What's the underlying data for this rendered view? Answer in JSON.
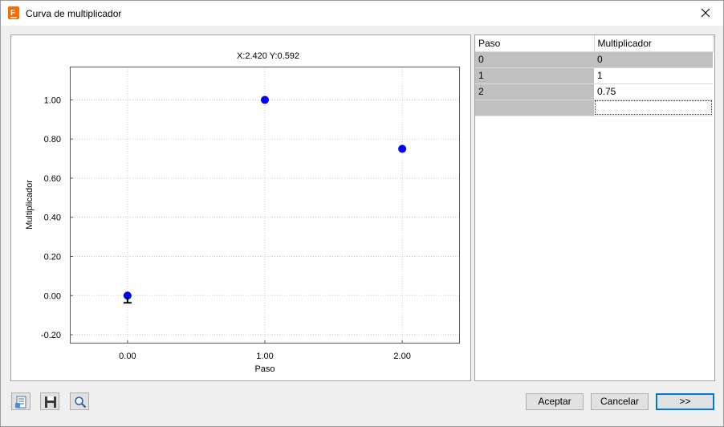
{
  "window": {
    "title": "Curva de multiplicador"
  },
  "chart": {
    "coord_readout": "X:2.420 Y:0.592",
    "chart_data": {
      "type": "scatter",
      "xlabel": "Paso",
      "ylabel": "Multiplicador",
      "x": [
        0,
        1,
        2
      ],
      "y": [
        0,
        1,
        0.75
      ],
      "xlim": [
        -0.42,
        2.42
      ],
      "ylim": [
        -0.245,
        1.17
      ],
      "xticks": [
        "0.00",
        "1.00",
        "2.00"
      ],
      "xtick_values": [
        0,
        1,
        2
      ],
      "yticks": [
        "1.00",
        "0.80",
        "0.60",
        "0.40",
        "0.20",
        "0.00",
        "-0.20"
      ],
      "ytick_values": [
        1.0,
        0.8,
        0.6,
        0.4,
        0.2,
        0.0,
        -0.2
      ],
      "grid": true,
      "marker_color": "#0000ff"
    }
  },
  "table": {
    "headers": [
      "Paso",
      "Multiplicador"
    ],
    "rows": [
      [
        "0",
        "0"
      ],
      [
        "1",
        "1"
      ],
      [
        "2",
        "0.75"
      ],
      [
        "",
        ""
      ]
    ]
  },
  "toolbar": {
    "icons": [
      "export-icon",
      "save-icon",
      "zoom-icon"
    ]
  },
  "buttons": {
    "accept": "Aceptar",
    "cancel": "Cancelar",
    "next": ">>"
  },
  "colors": {
    "accent": "#0078d7",
    "app_icon": "#ff6a00"
  }
}
